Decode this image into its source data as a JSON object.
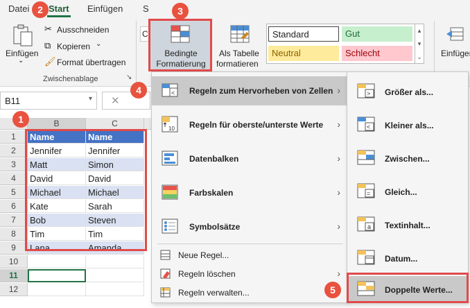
{
  "tabs": {
    "datei": "Datei",
    "start": "Start",
    "einfuegen": "Einfügen",
    "s": "S"
  },
  "clipboard": {
    "paste": "Einfügen",
    "cut": "Ausschneiden",
    "copy": "Kopieren",
    "format_painter": "Format übertragen",
    "group": "Zwischenablage"
  },
  "cf": {
    "line1": "Bedingte",
    "line2": "Formatierung"
  },
  "table": {
    "line1": "Als Tabelle",
    "line2": "formatieren"
  },
  "styles": {
    "standard": "Standard",
    "gut": "Gut",
    "neutral": "Neutral",
    "schlecht": "Schlecht"
  },
  "insert_right": "Einfüger",
  "name_box": "B11",
  "columns": [
    "B",
    "C"
  ],
  "rows": [
    "1",
    "2",
    "3",
    "4",
    "5",
    "6",
    "7",
    "8",
    "9",
    "10",
    "11",
    "12"
  ],
  "table_data": {
    "header": [
      "Name",
      "Name"
    ],
    "body": [
      [
        "Jennifer",
        "Jennifer"
      ],
      [
        "Matt",
        "Simon"
      ],
      [
        "David",
        "David"
      ],
      [
        "Michael",
        "Michael"
      ],
      [
        "Kate",
        "Sarah"
      ],
      [
        "Bob",
        "Steven"
      ],
      [
        "Tim",
        "Tim"
      ],
      [
        "Lana",
        "Amanda"
      ]
    ]
  },
  "menu_main": [
    {
      "label": "Regeln zum Hervorheben von Zellen",
      "arrow": "›"
    },
    {
      "label": "Regeln für oberste/unterste Werte",
      "arrow": "›"
    },
    {
      "label": "Datenbalken",
      "arrow": "›"
    },
    {
      "label": "Farbskalen",
      "arrow": "›"
    },
    {
      "label": "Symbolsätze",
      "arrow": "›"
    },
    {
      "label": "Neue Regel..."
    },
    {
      "label": "Regeln löschen",
      "arrow": "›"
    },
    {
      "label": "Regeln verwalten..."
    }
  ],
  "menu_sub": [
    {
      "label": "Größer als..."
    },
    {
      "label": "Kleiner als..."
    },
    {
      "label": "Zwischen..."
    },
    {
      "label": "Gleich..."
    },
    {
      "label": "Textinhalt..."
    },
    {
      "label": "Datum..."
    },
    {
      "label": "Doppelte Werte..."
    }
  ],
  "badges": [
    "1",
    "2",
    "3",
    "4",
    "5"
  ],
  "colors": {
    "accent": "#217346",
    "highlight_red": "#e04a4a",
    "table_header": "#4472c4",
    "table_band": "#d9e1f2"
  }
}
